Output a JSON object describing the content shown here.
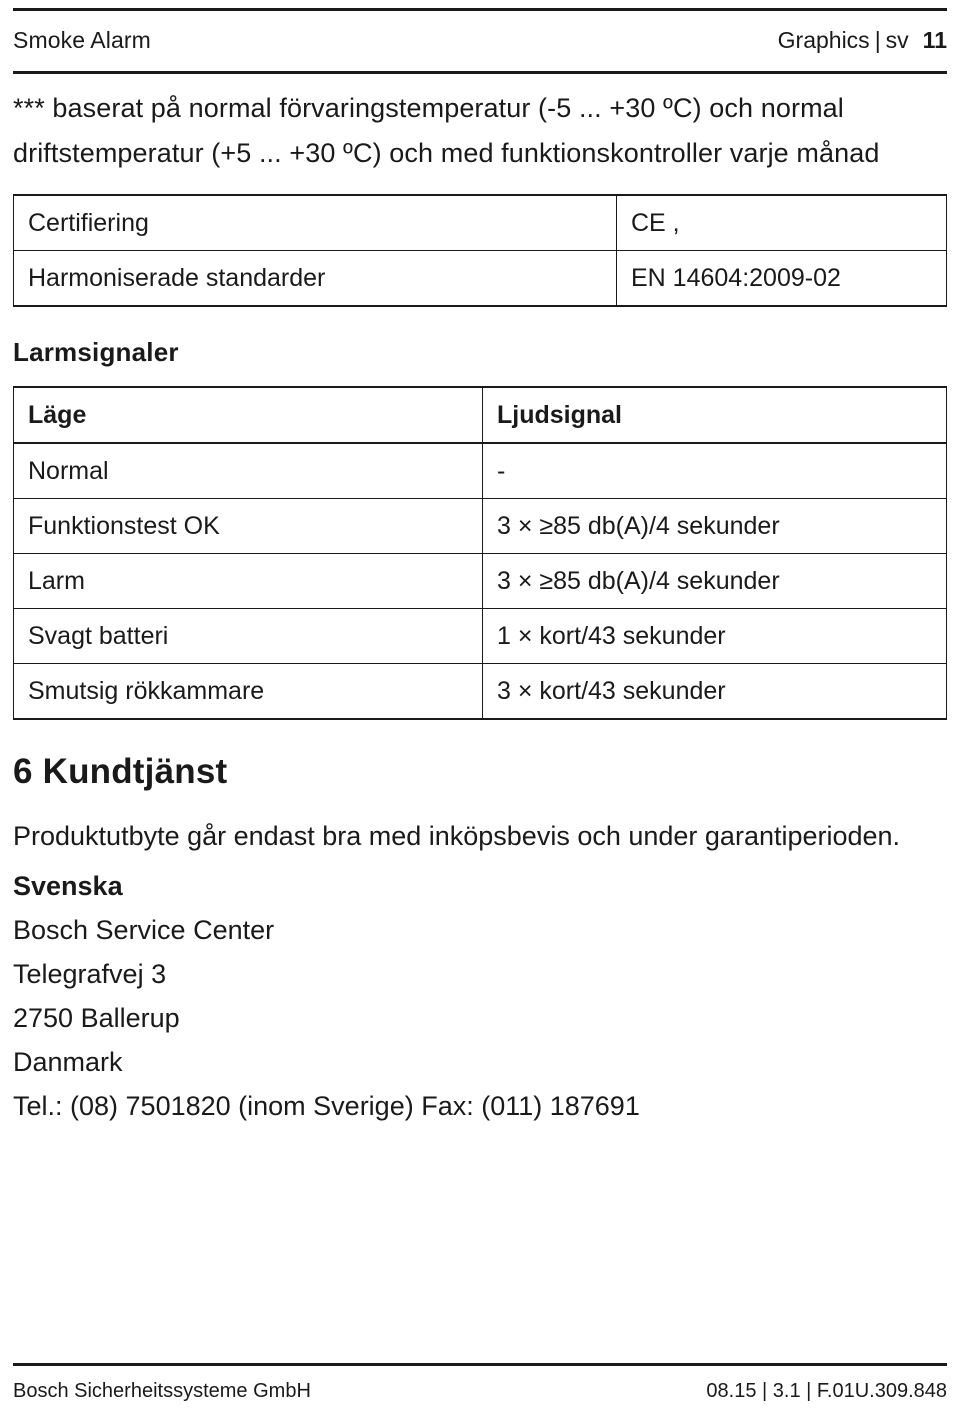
{
  "header": {
    "document_title": "Smoke Alarm",
    "section_label": "Graphics",
    "separator": "|",
    "language": "sv",
    "page_number": "11"
  },
  "footnote": "*** baserat på normal förvaringstemperatur (-5 ... +30 ºC) och normal driftstemperatur (+5 ... +30 ºC) och med funktionskontroller varje månad",
  "cert_table": {
    "rows": [
      {
        "label": "Certifiering",
        "value": "CE ,"
      },
      {
        "label": "Harmoniserade standarder",
        "value": "EN 14604:2009-02"
      }
    ]
  },
  "alarm_section": {
    "heading": "Larmsignaler",
    "columns": [
      "Läge",
      "Ljudsignal"
    ],
    "rows": [
      {
        "mode": "Normal",
        "signal": "-"
      },
      {
        "mode": "Funktionstest OK",
        "signal": "3 × ≥85 db(A)/4 sekunder"
      },
      {
        "mode": "Larm",
        "signal": "3 × ≥85 db(A)/4 sekunder"
      },
      {
        "mode": "Svagt batteri",
        "signal": "1 × kort/43 sekunder"
      },
      {
        "mode": "Smutsig rökkammare",
        "signal": "3 × kort/43 sekunder"
      }
    ]
  },
  "service_section": {
    "heading": "6 Kundtjänst",
    "paragraph": "Produktutbyte går endast bra med inköpsbevis och under garantiperioden.",
    "address": {
      "country": "Svenska",
      "lines": [
        "Bosch Service Center",
        "Telegrafvej 3",
        "2750 Ballerup",
        "Danmark",
        "Tel.: (08) 7501820 (inom Sverige) Fax: (011) 187691"
      ]
    }
  },
  "footer": {
    "company": "Bosch Sicherheitssysteme GmbH",
    "document_code": "08.15 | 3.1 | F.01U.309.848"
  }
}
